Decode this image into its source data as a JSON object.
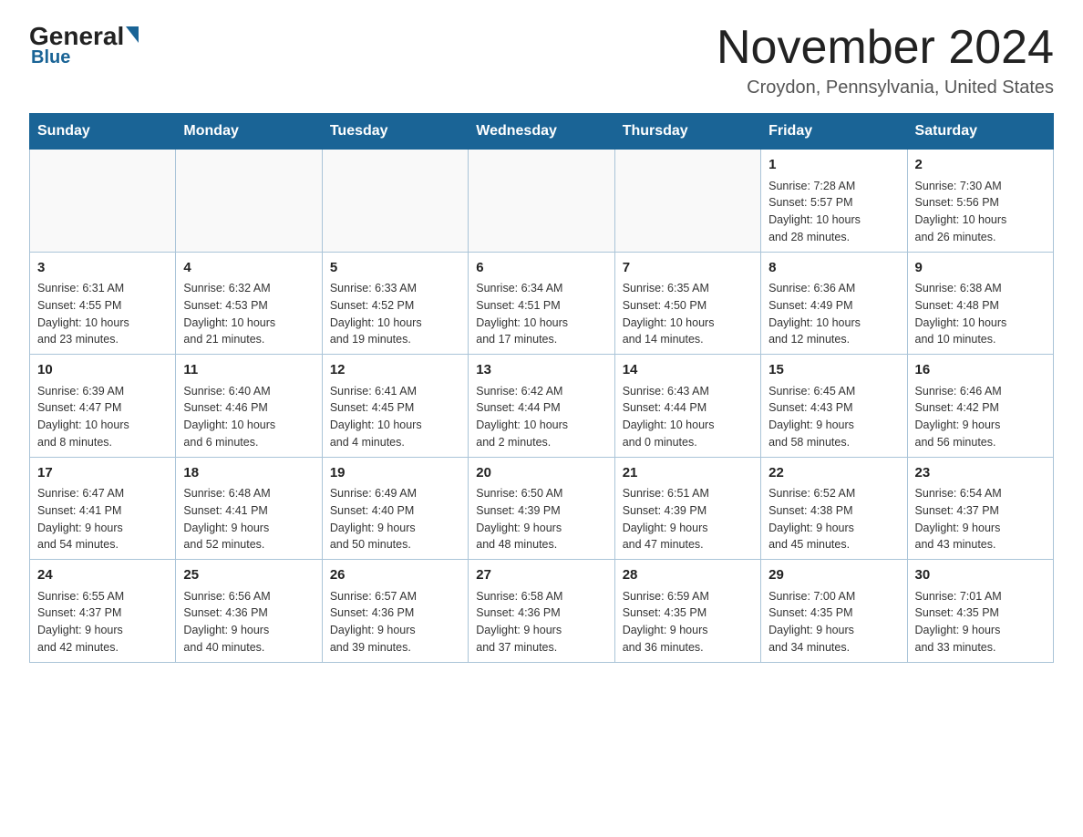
{
  "header": {
    "logo_text": "General",
    "logo_blue": "Blue",
    "month_title": "November 2024",
    "location": "Croydon, Pennsylvania, United States"
  },
  "weekdays": [
    "Sunday",
    "Monday",
    "Tuesday",
    "Wednesday",
    "Thursday",
    "Friday",
    "Saturday"
  ],
  "weeks": [
    [
      {
        "day": "",
        "info": ""
      },
      {
        "day": "",
        "info": ""
      },
      {
        "day": "",
        "info": ""
      },
      {
        "day": "",
        "info": ""
      },
      {
        "day": "",
        "info": ""
      },
      {
        "day": "1",
        "info": "Sunrise: 7:28 AM\nSunset: 5:57 PM\nDaylight: 10 hours\nand 28 minutes."
      },
      {
        "day": "2",
        "info": "Sunrise: 7:30 AM\nSunset: 5:56 PM\nDaylight: 10 hours\nand 26 minutes."
      }
    ],
    [
      {
        "day": "3",
        "info": "Sunrise: 6:31 AM\nSunset: 4:55 PM\nDaylight: 10 hours\nand 23 minutes."
      },
      {
        "day": "4",
        "info": "Sunrise: 6:32 AM\nSunset: 4:53 PM\nDaylight: 10 hours\nand 21 minutes."
      },
      {
        "day": "5",
        "info": "Sunrise: 6:33 AM\nSunset: 4:52 PM\nDaylight: 10 hours\nand 19 minutes."
      },
      {
        "day": "6",
        "info": "Sunrise: 6:34 AM\nSunset: 4:51 PM\nDaylight: 10 hours\nand 17 minutes."
      },
      {
        "day": "7",
        "info": "Sunrise: 6:35 AM\nSunset: 4:50 PM\nDaylight: 10 hours\nand 14 minutes."
      },
      {
        "day": "8",
        "info": "Sunrise: 6:36 AM\nSunset: 4:49 PM\nDaylight: 10 hours\nand 12 minutes."
      },
      {
        "day": "9",
        "info": "Sunrise: 6:38 AM\nSunset: 4:48 PM\nDaylight: 10 hours\nand 10 minutes."
      }
    ],
    [
      {
        "day": "10",
        "info": "Sunrise: 6:39 AM\nSunset: 4:47 PM\nDaylight: 10 hours\nand 8 minutes."
      },
      {
        "day": "11",
        "info": "Sunrise: 6:40 AM\nSunset: 4:46 PM\nDaylight: 10 hours\nand 6 minutes."
      },
      {
        "day": "12",
        "info": "Sunrise: 6:41 AM\nSunset: 4:45 PM\nDaylight: 10 hours\nand 4 minutes."
      },
      {
        "day": "13",
        "info": "Sunrise: 6:42 AM\nSunset: 4:44 PM\nDaylight: 10 hours\nand 2 minutes."
      },
      {
        "day": "14",
        "info": "Sunrise: 6:43 AM\nSunset: 4:44 PM\nDaylight: 10 hours\nand 0 minutes."
      },
      {
        "day": "15",
        "info": "Sunrise: 6:45 AM\nSunset: 4:43 PM\nDaylight: 9 hours\nand 58 minutes."
      },
      {
        "day": "16",
        "info": "Sunrise: 6:46 AM\nSunset: 4:42 PM\nDaylight: 9 hours\nand 56 minutes."
      }
    ],
    [
      {
        "day": "17",
        "info": "Sunrise: 6:47 AM\nSunset: 4:41 PM\nDaylight: 9 hours\nand 54 minutes."
      },
      {
        "day": "18",
        "info": "Sunrise: 6:48 AM\nSunset: 4:41 PM\nDaylight: 9 hours\nand 52 minutes."
      },
      {
        "day": "19",
        "info": "Sunrise: 6:49 AM\nSunset: 4:40 PM\nDaylight: 9 hours\nand 50 minutes."
      },
      {
        "day": "20",
        "info": "Sunrise: 6:50 AM\nSunset: 4:39 PM\nDaylight: 9 hours\nand 48 minutes."
      },
      {
        "day": "21",
        "info": "Sunrise: 6:51 AM\nSunset: 4:39 PM\nDaylight: 9 hours\nand 47 minutes."
      },
      {
        "day": "22",
        "info": "Sunrise: 6:52 AM\nSunset: 4:38 PM\nDaylight: 9 hours\nand 45 minutes."
      },
      {
        "day": "23",
        "info": "Sunrise: 6:54 AM\nSunset: 4:37 PM\nDaylight: 9 hours\nand 43 minutes."
      }
    ],
    [
      {
        "day": "24",
        "info": "Sunrise: 6:55 AM\nSunset: 4:37 PM\nDaylight: 9 hours\nand 42 minutes."
      },
      {
        "day": "25",
        "info": "Sunrise: 6:56 AM\nSunset: 4:36 PM\nDaylight: 9 hours\nand 40 minutes."
      },
      {
        "day": "26",
        "info": "Sunrise: 6:57 AM\nSunset: 4:36 PM\nDaylight: 9 hours\nand 39 minutes."
      },
      {
        "day": "27",
        "info": "Sunrise: 6:58 AM\nSunset: 4:36 PM\nDaylight: 9 hours\nand 37 minutes."
      },
      {
        "day": "28",
        "info": "Sunrise: 6:59 AM\nSunset: 4:35 PM\nDaylight: 9 hours\nand 36 minutes."
      },
      {
        "day": "29",
        "info": "Sunrise: 7:00 AM\nSunset: 4:35 PM\nDaylight: 9 hours\nand 34 minutes."
      },
      {
        "day": "30",
        "info": "Sunrise: 7:01 AM\nSunset: 4:35 PM\nDaylight: 9 hours\nand 33 minutes."
      }
    ]
  ]
}
